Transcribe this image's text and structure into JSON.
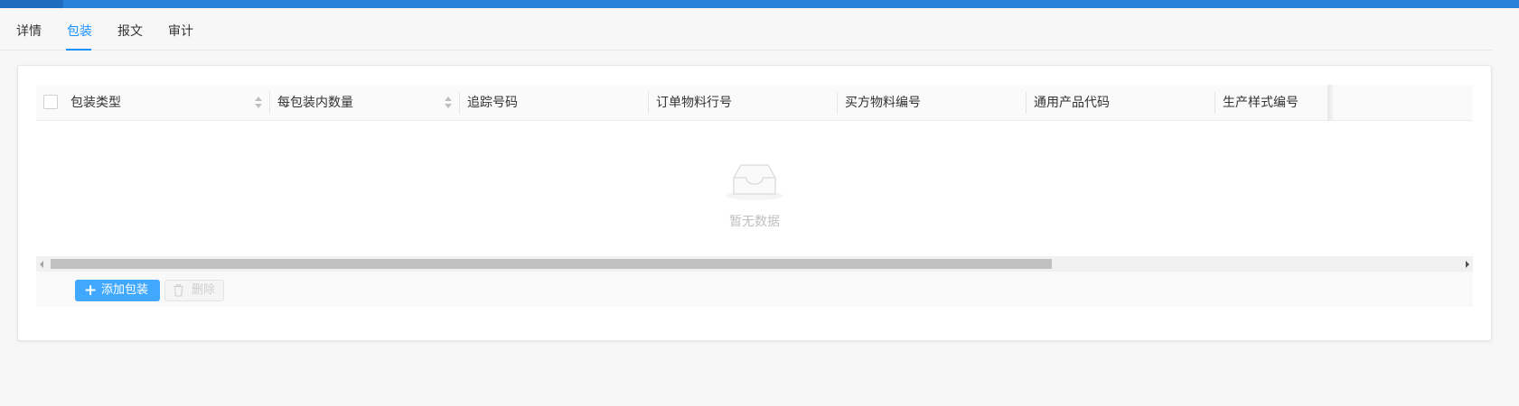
{
  "tabs": [
    {
      "label": "详情",
      "active": false
    },
    {
      "label": "包装",
      "active": true
    },
    {
      "label": "报文",
      "active": false
    },
    {
      "label": "审计",
      "active": false
    }
  ],
  "table": {
    "columns": [
      {
        "label": "包装类型",
        "sortable": true
      },
      {
        "label": "每包装内数量",
        "sortable": true
      },
      {
        "label": "追踪号码",
        "sortable": false
      },
      {
        "label": "订单物料行号",
        "sortable": false
      },
      {
        "label": "买方物料编号",
        "sortable": false
      },
      {
        "label": "通用产品代码",
        "sortable": false
      },
      {
        "label": "生产样式编号",
        "sortable": false
      }
    ],
    "empty_text": "暂无数据",
    "scroll_position": 0.0,
    "scroll_visible_fraction": 0.7
  },
  "actions": {
    "add_label": "添加包装",
    "delete_label": "删除",
    "delete_disabled": true
  },
  "colors": {
    "accent": "#1890ff",
    "topbar": "#2a82d8",
    "add_button": "#40a9ff"
  },
  "icons": {
    "add": "plus-icon",
    "delete": "trash-icon",
    "empty": "empty-inbox-icon",
    "sort": "sort-icon"
  }
}
